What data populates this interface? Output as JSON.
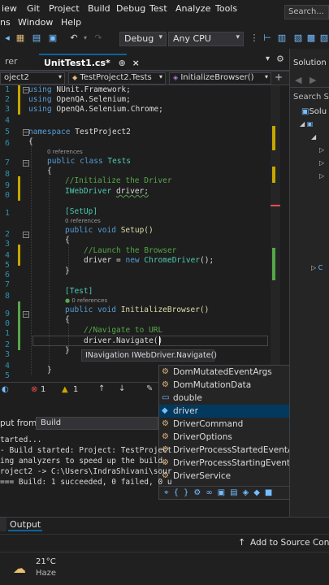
{
  "menu": {
    "row1": [
      "iew",
      "Git",
      "Project",
      "Build",
      "Debug",
      "Test",
      "Analyze",
      "Tools"
    ],
    "row2": [
      "ns",
      "Window",
      "Help"
    ],
    "search": "Search..."
  },
  "toolbar": {
    "config": "Debug",
    "platform": "Any CPU"
  },
  "tabs": {
    "left_partial": "rer",
    "active": "UnitTest1.cs*",
    "pin": "⊕",
    "close": "×",
    "overflow": "▾",
    "gear": "⚙"
  },
  "nav": {
    "project": "oject2",
    "class": "TestProject2.Tests",
    "member": "InitializeBrowser()"
  },
  "code": {
    "line_numbers": [
      "1",
      "2",
      "3",
      "4",
      "5",
      "6",
      "7",
      "8",
      "9",
      "0",
      "1",
      "2",
      "3",
      "4",
      "5",
      "6",
      "7",
      "8",
      "9",
      "0",
      "1",
      "2",
      "3",
      "4",
      "5"
    ],
    "using1": "NUnit.Framework;",
    "using2": "OpenQA.Selenium;",
    "using3": "OpenQA.Selenium.Chrome;",
    "namespace_kw": "namespace",
    "namespace_name": "TestProject2",
    "refs0": "0 references",
    "public": "public",
    "class_kw": "class",
    "class_name": "Tests",
    "comment_init": "//Initialize the Driver",
    "driver_type": "IWebDriver",
    "driver_var": "driver;",
    "attr_setup": "[SetUp]",
    "refs_setup": "0 references",
    "void": "void",
    "setup_name": "Setup()",
    "comment_launch": "//Launch the Browser",
    "assign_driver": "driver = ",
    "new_kw": "new",
    "chrome_driver": "ChromeDriver",
    "assign_end": "();",
    "attr_test": "[Test]",
    "refs_test": "0 references",
    "init_name": "InitializeBrowser()",
    "comment_nav": "//Navigate to URL",
    "nav_call": "driver.Navigate()",
    "open_brace": "{",
    "close_brace": "}"
  },
  "tooltip": "INavigation IWebDriver.Navigate()",
  "completion": {
    "items": [
      "DomMutatedEventArgs",
      "DomMutationData",
      "double",
      "driver",
      "DriverCommand",
      "DriverOptions",
      "DriverProcessStartedEventArgs",
      "DriverProcessStartingEventArgs",
      "DriverService"
    ],
    "selected_index": 3,
    "filter_icons": "⌖{}⚙∞▣▤◈◆■"
  },
  "editor_status": {
    "errors": "1",
    "warnings": "1"
  },
  "output": {
    "from_label": "put from:",
    "from_value": "Build",
    "lines": [
      "tarted...",
      "- Build started: Project: TestProject",
      "ing analyzers to speed up the build.",
      "roject2 -> C:\\Users\\IndraShivani\\sour",
      "=== Build: 1 succeeded, 0 failed, 0 u"
    ],
    "tab_label": "Output"
  },
  "statusbar": {
    "source_control": "Add to Source Contro"
  },
  "taskbar": {
    "temperature": "21°C",
    "condition": "Haze"
  },
  "solution": {
    "title": "Solution E",
    "search": "Search So",
    "item1": "Solu"
  },
  "colors": {
    "accent": "#0e639c",
    "keyword": "#569cd6",
    "type": "#4ec9b0",
    "comment": "#57a64a",
    "selection": "#04395e"
  }
}
